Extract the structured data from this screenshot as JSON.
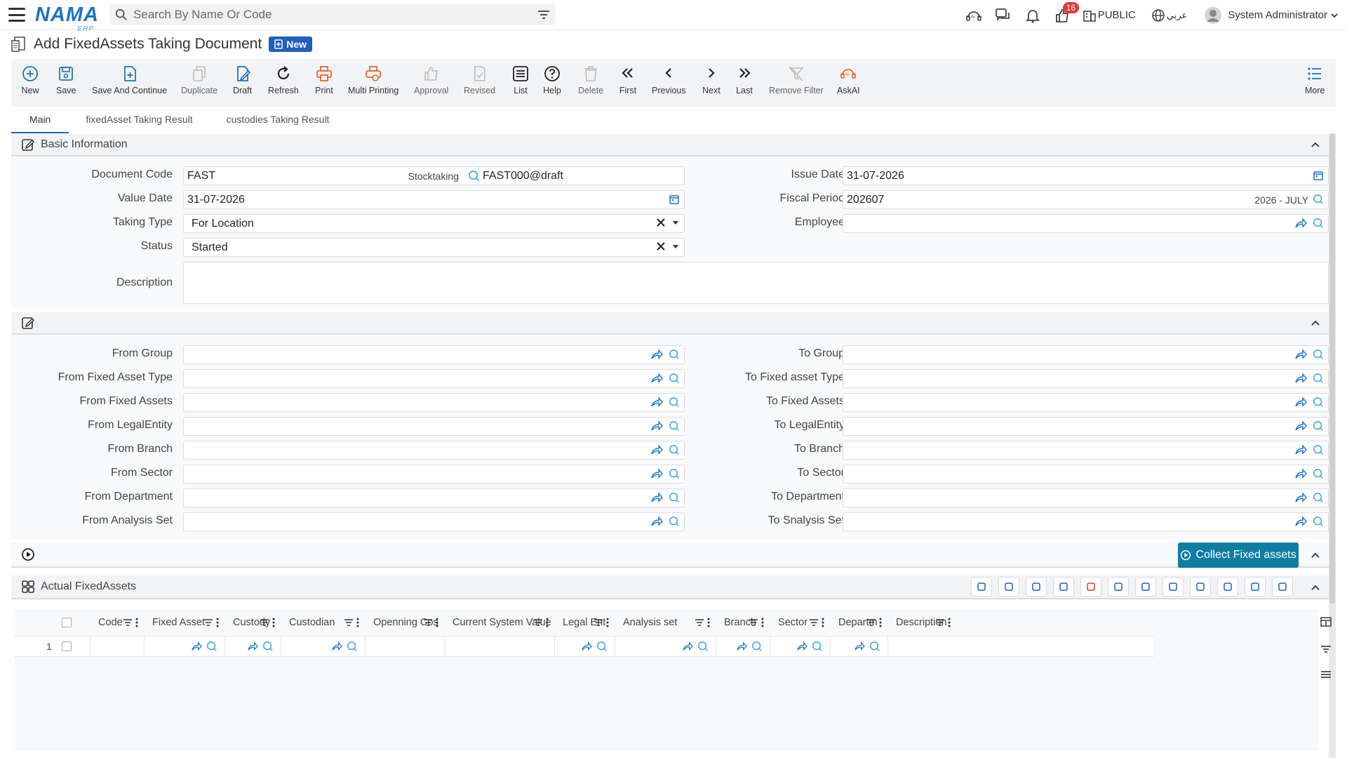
{
  "app": {
    "logo": "NAMA",
    "logo_sub": "ERP"
  },
  "search": {
    "placeholder": "Search By Name Or Code"
  },
  "top": {
    "notifications_count": "16",
    "public_label": "PUBLIC",
    "language_label": "عربي",
    "user_name": "System Administrator"
  },
  "page": {
    "title": "Add FixedAssets Taking Document",
    "badge": "New"
  },
  "toolbar": {
    "new": "New",
    "save": "Save",
    "save_continue": "Save And Continue",
    "duplicate": "Duplicate",
    "draft": "Draft",
    "refresh": "Refresh",
    "print": "Print",
    "multi_printing": "Multi Printing",
    "approval": "Approval",
    "revised": "Revised",
    "list": "List",
    "help": "Help",
    "delete": "Delete",
    "first": "First",
    "previous": "Previous",
    "next": "Next",
    "last": "Last",
    "remove_filter": "Remove Filter",
    "askai": "AskAI",
    "more": "More"
  },
  "tabs": [
    "Main",
    "fixedAsset Taking Result",
    "custodies Taking Result"
  ],
  "basic": {
    "title": "Basic Information",
    "document_code_label": "Document Code",
    "document_code_value": "FAST",
    "document_code_tag": "Stocktaking",
    "document_code_number": "FAST000@draft",
    "issue_date_label": "Issue Date",
    "issue_date_value": "31-07-2026",
    "value_date_label": "Value Date",
    "value_date_value": "31-07-2026",
    "fiscal_period_label": "Fiscal Period",
    "fiscal_period_value": "202607",
    "fiscal_period_tag": "2026 - JULY",
    "taking_type_label": "Taking Type",
    "taking_type_value": "For Location",
    "employee_label": "Employee",
    "employee_value": "",
    "status_label": "Status",
    "status_value": "Started",
    "description_label": "Description"
  },
  "filters": {
    "from_group": "From Group",
    "to_group": "To Group",
    "from_type": "From Fixed Asset Type",
    "to_type": "To Fixed asset Type",
    "from_assets": "From Fixed Assets",
    "to_assets": "To Fixed Assets",
    "from_legal": "From LegalEntity",
    "to_legal": "To LegalEntity",
    "from_branch": "From Branch",
    "to_branch": "To Branch",
    "from_sector": "From Sector",
    "to_sector": "To Sector",
    "from_department": "From Department",
    "to_department": "To Department",
    "from_analysis": "From Analysis Set",
    "to_analysis": "To Snalysis Set"
  },
  "collect": {
    "label": "Collect Fixed assets"
  },
  "actual": {
    "title": "Actual FixedAssets",
    "columns": [
      "Code",
      "Fixed Asset",
      "Custody",
      "Custodian",
      "Openning Cos",
      "Current System Value",
      "Legal Ent",
      "Analysis set",
      "Branch",
      "Sector",
      "Departm",
      "Description"
    ],
    "row_number": "1"
  },
  "colors": {
    "brand": "#1e73be",
    "accent": "#1e5fbf",
    "collect": "#0f7da1",
    "print_icon": "#e8682a",
    "badge": "#e53935"
  }
}
